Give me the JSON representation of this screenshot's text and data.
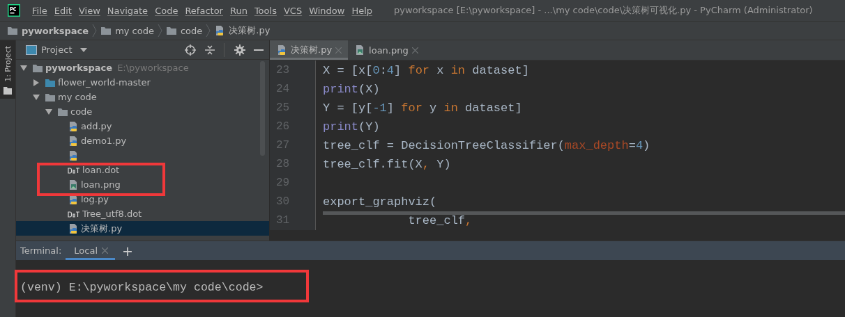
{
  "window": {
    "title": "pyworkspace [E:\\pyworkspace] - ...\\my code\\code\\决策树可视化.py - PyCharm (Administrator)"
  },
  "menu": [
    "File",
    "Edit",
    "View",
    "Navigate",
    "Code",
    "Refactor",
    "Run",
    "Tools",
    "VCS",
    "Window",
    "Help"
  ],
  "breadcrumbs": [
    {
      "label": "pyworkspace",
      "kind": "folder"
    },
    {
      "label": "my code",
      "kind": "folder"
    },
    {
      "label": "code",
      "kind": "folder"
    },
    {
      "label": "决策树.py",
      "kind": "python"
    }
  ],
  "side_stripe": {
    "label": "1: Project"
  },
  "project_panel": {
    "title": "Project",
    "tree": [
      {
        "label": "pyworkspace",
        "path": "E:\\pyworkspace",
        "kind": "folder",
        "expanded": true,
        "selected": false,
        "children": [
          {
            "label": "flower_world-master",
            "kind": "module",
            "expanded": false,
            "selected": false
          },
          {
            "label": "my code",
            "kind": "folder",
            "expanded": true,
            "selected": false,
            "children": [
              {
                "label": "code",
                "kind": "folder",
                "expanded": true,
                "selected": false,
                "children": [
                  {
                    "label": "add.py",
                    "kind": "python",
                    "selected": false
                  },
                  {
                    "label": "demo1.py",
                    "kind": "python",
                    "selected": false
                  },
                  {
                    "kind": "python"
                  },
                  {
                    "label": "loan.dot",
                    "kind": "dot",
                    "selected": false,
                    "highlighted": true
                  },
                  {
                    "label": "loan.png",
                    "kind": "image",
                    "selected": false,
                    "highlighted": true
                  },
                  {
                    "label": "log.py",
                    "kind": "python",
                    "selected": false
                  },
                  {
                    "label": "Tree_utf8.dot",
                    "kind": "dot",
                    "selected": false
                  },
                  {
                    "label": "决策树.py",
                    "kind": "python",
                    "selected": true
                  }
                ]
              }
            ]
          }
        ]
      }
    ]
  },
  "editor": {
    "tabs": [
      {
        "label": "决策树.py",
        "kind": "python",
        "selected": true
      },
      {
        "label": "loan.png",
        "kind": "image",
        "selected": false
      }
    ],
    "lines": [
      {
        "number": "23",
        "tokens": [
          {
            "text": "X = [x[",
            "kind": "plain"
          },
          {
            "text": "0",
            "kind": "number"
          },
          {
            "text": ":",
            "kind": "plain"
          },
          {
            "text": "4",
            "kind": "number"
          },
          {
            "text": "] ",
            "kind": "plain"
          },
          {
            "text": "for",
            "kind": "keyword"
          },
          {
            "text": " x ",
            "kind": "plain"
          },
          {
            "text": "in",
            "kind": "keyword"
          },
          {
            "text": " dataset]",
            "kind": "plain"
          }
        ]
      },
      {
        "number": "24",
        "tokens": [
          {
            "text": "print",
            "kind": "builtin"
          },
          {
            "text": "(X)",
            "kind": "plain"
          }
        ]
      },
      {
        "number": "25",
        "tokens": [
          {
            "text": "Y = [y[",
            "kind": "plain"
          },
          {
            "text": "-1",
            "kind": "number"
          },
          {
            "text": "] ",
            "kind": "plain"
          },
          {
            "text": "for",
            "kind": "keyword"
          },
          {
            "text": " y ",
            "kind": "plain"
          },
          {
            "text": "in",
            "kind": "keyword"
          },
          {
            "text": " dataset]",
            "kind": "plain"
          }
        ]
      },
      {
        "number": "26",
        "tokens": [
          {
            "text": "print",
            "kind": "builtin"
          },
          {
            "text": "(Y)",
            "kind": "plain"
          }
        ]
      },
      {
        "number": "27",
        "tokens": [
          {
            "text": "tree_clf = DecisionTreeClassifier(",
            "kind": "plain"
          },
          {
            "text": "max_depth",
            "kind": "param"
          },
          {
            "text": "=",
            "kind": "plain"
          },
          {
            "text": "4",
            "kind": "number"
          },
          {
            "text": ")",
            "kind": "plain"
          }
        ]
      },
      {
        "number": "28",
        "tokens": [
          {
            "text": "tree_clf.fit(X",
            "kind": "plain"
          },
          {
            "text": ",",
            "kind": "keyword"
          },
          {
            "text": " Y)",
            "kind": "plain"
          }
        ]
      },
      {
        "number": "29"
      },
      {
        "number": "30",
        "tokens": [
          {
            "text": "export_graphviz(",
            "kind": "plain"
          }
        ]
      },
      {
        "number": "31",
        "tokens": [
          {
            "text": "            tree_clf",
            "kind": "plain"
          },
          {
            "text": ",",
            "kind": "keyword"
          }
        ]
      }
    ]
  },
  "terminal": {
    "label": "Terminal:",
    "tabs": [
      {
        "label": "Local",
        "selected": true
      }
    ],
    "add": "+",
    "prompt": "(venv) E:\\pyworkspace\\my code\\code>",
    "highlighted": true
  }
}
